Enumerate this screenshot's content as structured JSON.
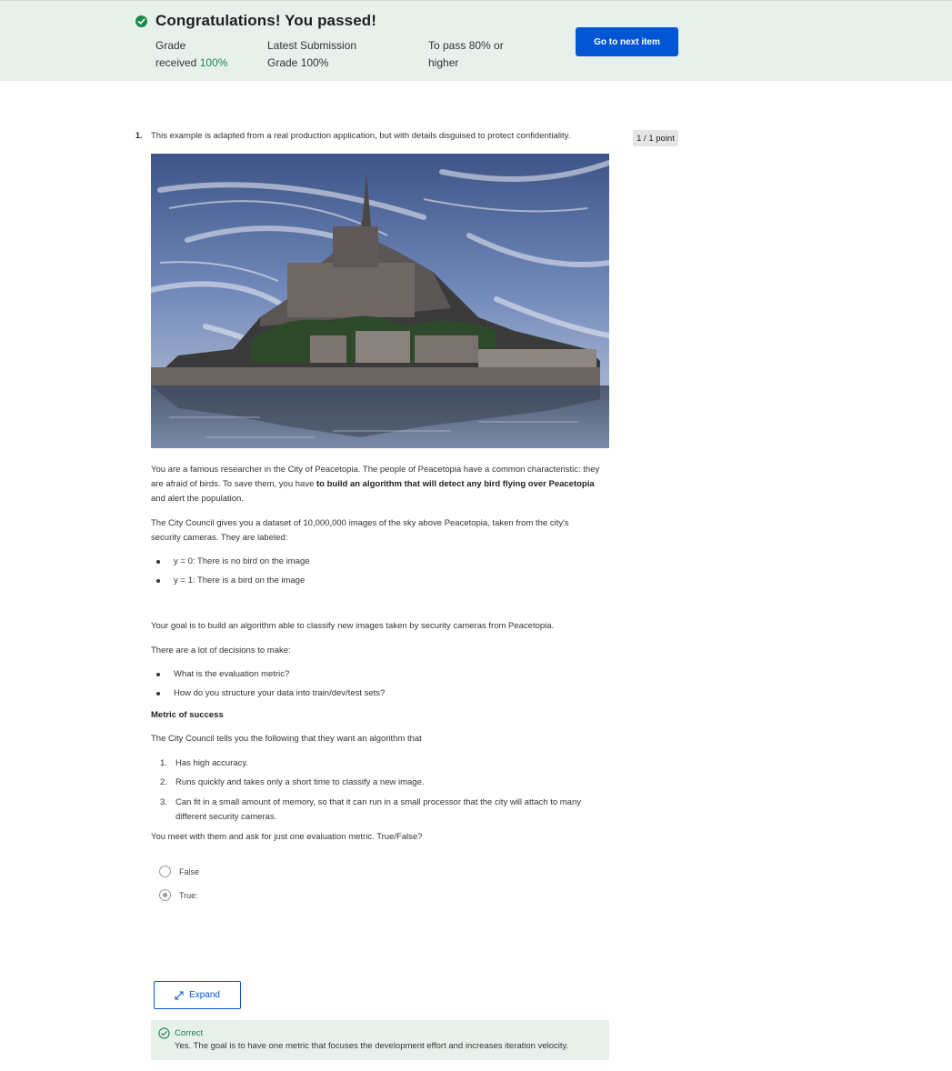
{
  "banner": {
    "title": "Congratulations! You passed!",
    "grade_label_1": "Grade",
    "grade_label_2": "received",
    "grade_value": "100%",
    "latest_label_1": "Latest Submission",
    "latest_label_2": "Grade",
    "latest_value": "100%",
    "pass_label_1": "To pass",
    "pass_value": "80% or",
    "pass_label_2": "higher",
    "next_button": "Go to next item"
  },
  "question": {
    "number": "1.",
    "intro": "This example is adapted from a real production application, but with details disguised to protect confidentiality.",
    "points": "1 / 1 point",
    "para1_a": "You are a famous researcher in the City of Peacetopia. The people of Peacetopia have a common characteristic: they are afraid of birds. To save them, you have ",
    "para1_bold": "to build an algorithm that will detect any bird flying over Peacetopia",
    "para1_b": " and alert the population.",
    "para2": "The City Council gives you a dataset of 10,000,000 images of the sky above Peacetopia, taken from the city's security cameras. They are labeled:",
    "labels": [
      "y = 0: There is no bird on the image",
      "y = 1: There is a bird on the image"
    ],
    "para3": "Your goal is to build an algorithm able to classify new images taken by security cameras from Peacetopia.",
    "para4": "There are a lot of decisions to make:",
    "decisions": [
      "What is the evaluation metric?",
      "How do you structure your data into train/dev/test sets?"
    ],
    "metric_heading": "Metric of success",
    "para5": "The City Council tells you the following that they want an algorithm that",
    "requirements": [
      {
        "num": "1.",
        "text": "Has high accuracy."
      },
      {
        "num": "2.",
        "text": "Runs quickly and takes only a short time to classify a new image."
      },
      {
        "num": "3.",
        "text": "Can fit in a small amount of memory, so that it can run in a small processor that the city will attach to many different security cameras."
      }
    ],
    "prompt": "You meet with them and ask for just one evaluation metric. True/False?",
    "options": [
      {
        "label": "False",
        "selected": false
      },
      {
        "label": "True:",
        "selected": true
      }
    ],
    "expand_label": "Expand",
    "feedback_title": "Correct",
    "feedback_text": "Yes. The goal is to have one metric that focuses the development effort and increases iteration velocity."
  },
  "colors": {
    "accent": "#0056d2",
    "success": "#1b8a4c",
    "banner_bg": "#e8f0ec"
  },
  "icons": {
    "banner": "check-circle-icon",
    "expand": "expand-arrows-icon",
    "feedback": "check-circle-outline-icon"
  }
}
